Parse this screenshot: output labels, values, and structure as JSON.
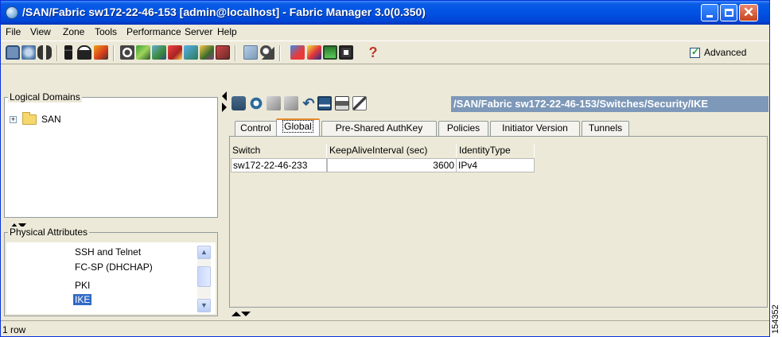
{
  "window": {
    "title": "/SAN/Fabric sw172-22-46-153 [admin@localhost] - Fabric Manager 3.0(0.350)"
  },
  "menu": [
    {
      "label": "File"
    },
    {
      "label": "View"
    },
    {
      "label": "Zone"
    },
    {
      "label": "Tools"
    },
    {
      "label": "Performance"
    },
    {
      "label": "Server"
    },
    {
      "label": "Help"
    }
  ],
  "toolbar": {
    "advanced_label": "Advanced",
    "advanced_checked": true
  },
  "logical_domains": {
    "title": "Logical Domains",
    "tree": [
      {
        "label": "SAN",
        "icon": "folder-icon"
      }
    ]
  },
  "physical_attributes": {
    "title": "Physical Attributes",
    "items": [
      "SSH and Telnet",
      "FC-SP (DHCHAP)",
      "PKI",
      "IKE"
    ],
    "selected": "IKE"
  },
  "content": {
    "path": "/SAN/Fabric sw172-22-46-153/Switches/Security/IKE",
    "tabs": [
      "Control",
      "Global",
      "Pre-Shared AuthKey",
      "Policies",
      "Initiator Version",
      "Tunnels"
    ],
    "active_tab": "Global",
    "table": {
      "columns": [
        "Switch",
        "KeepAliveInterval (sec)",
        "IdentityType"
      ],
      "rows": [
        [
          "sw172-22-46-233",
          "3600",
          "IPv4"
        ]
      ]
    }
  },
  "status": {
    "text": "1 row"
  },
  "figure_id": "154352",
  "colors": {
    "titlebar": "#0255e6",
    "path_label_bg": "#7d98b8",
    "selection": "#316ac5",
    "active_tab_accent": "#e68b2c"
  }
}
